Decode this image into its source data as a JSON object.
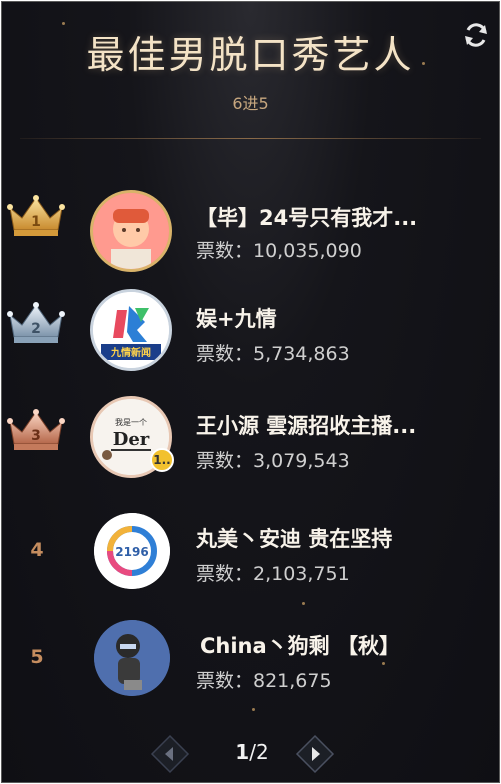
{
  "header": {
    "title": "最佳男脱口秀艺人",
    "subtitle": "6进5"
  },
  "accent_color": "#c58d5f",
  "entries": [
    {
      "rank": "1",
      "crown": "gold-crown-icon",
      "name": "【毕】24号只有我才...",
      "votes": "票数：10,035,090"
    },
    {
      "rank": "2",
      "crown": "silver-crown-icon",
      "name": "娱+九情",
      "votes": "票数：5,734,863",
      "avatar_text": "九情新闻"
    },
    {
      "rank": "3",
      "crown": "bronze-crown-icon",
      "name": "王小源 雲源招收主播...",
      "votes": "票数：3,079,543",
      "avatar_text": "Der",
      "avatar_small": "我是一个",
      "badge": "1.."
    },
    {
      "rank": "4",
      "name": "丸美丶安迪 贵在坚持",
      "votes": "票数：2,103,751",
      "avatar_text": "2196"
    },
    {
      "rank": "5",
      "name": "China丶狗剩 【秋】",
      "votes": "票数：821,675"
    }
  ],
  "pager": {
    "current": "1",
    "total": "/2"
  }
}
